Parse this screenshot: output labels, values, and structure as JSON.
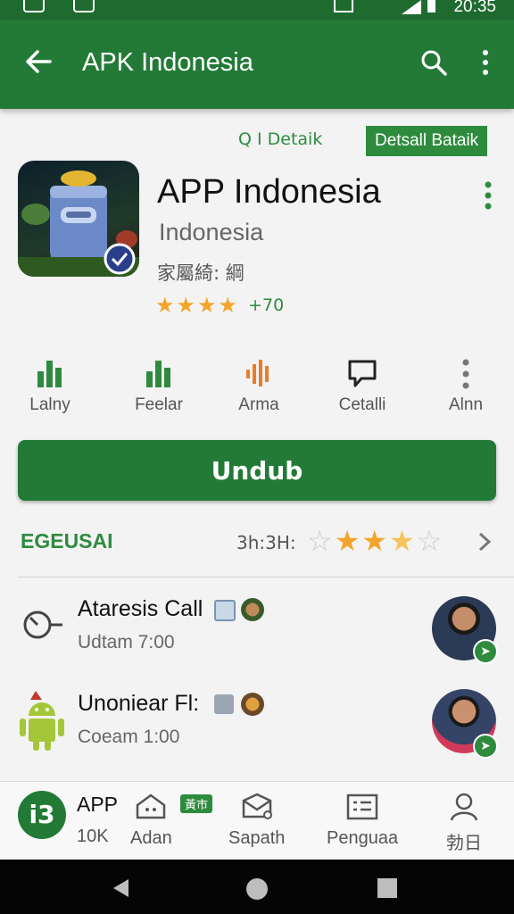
{
  "status_bar": {
    "time": "20:35"
  },
  "app_bar": {
    "title": "APK Indonesia"
  },
  "links": {
    "detail_link": "Q I Detaik",
    "detail_button": "Detsall Bataik"
  },
  "app": {
    "name": "APP Indonesia",
    "publisher": "Indonesia",
    "category": "家屬綺: 綱",
    "rating_stars": 4,
    "rating_count": "+70"
  },
  "actions": [
    {
      "icon": "bar-chart-icon",
      "label": "Lalny"
    },
    {
      "icon": "bar-chart-icon",
      "label": "Feelar"
    },
    {
      "icon": "audio-wave-icon",
      "label": "Arma"
    },
    {
      "icon": "comment-icon",
      "label": "Cetalli"
    },
    {
      "icon": "more-vert-icon",
      "label": "Alnn"
    }
  ],
  "download_label": "Undub",
  "rating_row": {
    "label": "EGEUSAI",
    "summary": "3h:3H:",
    "stars_filled": 3.5,
    "stars_total": 5
  },
  "list": [
    {
      "icon": "clock-icon",
      "title": "Ataresis Call",
      "subtitle": "Udtam 7:00"
    },
    {
      "icon": "android-icon",
      "title": "Unoniear Fl:",
      "subtitle": "Coeam 1:00"
    }
  ],
  "bottom_nav": {
    "app_label": "APP",
    "app_count": "10K",
    "tag": "黃市",
    "items": [
      {
        "icon": "home-icon",
        "label": "Adan"
      },
      {
        "icon": "inbox-icon",
        "label": "Sapath"
      },
      {
        "icon": "list-icon",
        "label": "Penguaa"
      },
      {
        "icon": "person-icon",
        "label": "勃日"
      }
    ]
  },
  "colors": {
    "primary": "#237a37",
    "accent": "#2e8b3e",
    "star": "#f2a52a"
  }
}
